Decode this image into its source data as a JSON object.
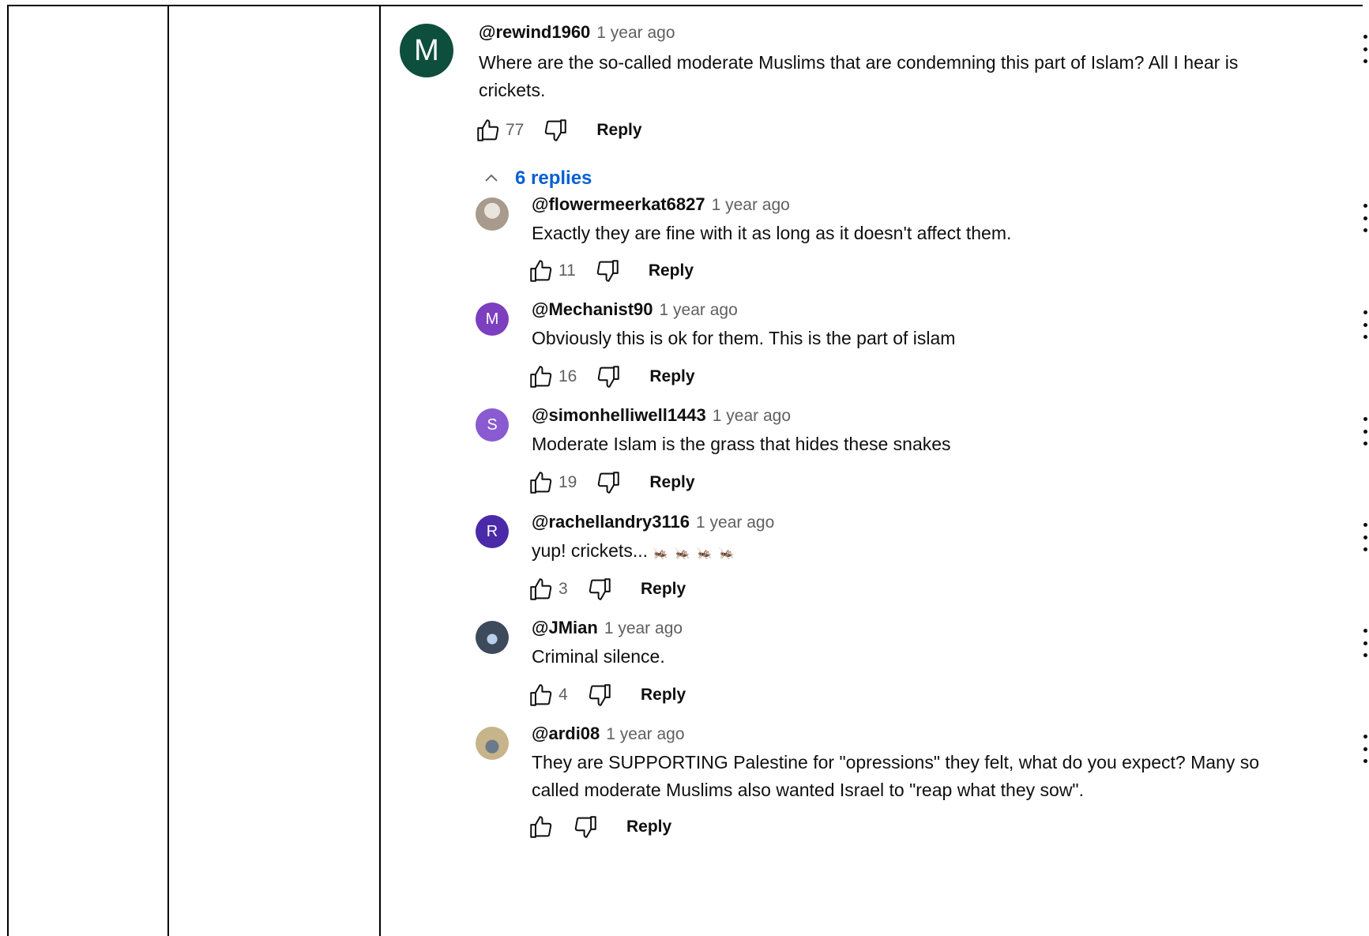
{
  "main_comment": {
    "avatar_letter": "M",
    "avatar_color": "#0d4f3c",
    "author": "@rewind1960",
    "time": "1 year ago",
    "text_line1": "Where are the so-called moderate Muslims that are condemning this part of Islam?  All I hear is",
    "text_line2": "crickets.",
    "likes": "77",
    "reply_label": "Reply"
  },
  "replies_toggle": {
    "label": "6 replies",
    "icon": "chevron-up-icon"
  },
  "replies": [
    {
      "avatar_letter": "",
      "avatar_color": "#a89a8c",
      "author": "@flowermeerkat6827",
      "time": "1 year ago",
      "text": "Exactly they are fine with it as long as it doesn't affect them.",
      "likes": "11",
      "reply_label": "Reply"
    },
    {
      "avatar_letter": "M",
      "avatar_color": "#7b3fbf",
      "author": "@Mechanist90",
      "time": "1 year ago",
      "text": "Obviously this is ok for them. This is the part of islam",
      "likes": "16",
      "reply_label": "Reply"
    },
    {
      "avatar_letter": "S",
      "avatar_color": "#8a5ad0",
      "author": "@simonhelliwell1443",
      "time": "1 year ago",
      "text": "Moderate Islam is the grass that hides these snakes",
      "likes": "19",
      "reply_label": "Reply"
    },
    {
      "avatar_letter": "R",
      "avatar_color": "#4a2aa8",
      "author": "@rachellandry3116",
      "time": "1 year ago",
      "text": "yup! crickets...",
      "emoji": "🦗🦗🦗🦗",
      "likes": "3",
      "reply_label": "Reply"
    },
    {
      "avatar_letter": "",
      "avatar_color": "#3d4a5c",
      "author": "@JMian",
      "time": "1 year ago",
      "text": "Criminal silence.",
      "likes": "4",
      "reply_label": "Reply"
    },
    {
      "avatar_letter": "",
      "avatar_color": "#8c7a5a",
      "author": "@ardi08",
      "time": "1 year ago",
      "text_line1": "They are SUPPORTING Palestine for \"opressions\" they felt, what do you expect? Many so",
      "text_line2": "called moderate Muslims also wanted Israel to \"reap what they sow\".",
      "likes": "",
      "reply_label": "Reply"
    }
  ],
  "icons": {
    "like": "thumbs-up-icon",
    "dislike": "thumbs-down-icon",
    "more": "more-vert-icon"
  }
}
